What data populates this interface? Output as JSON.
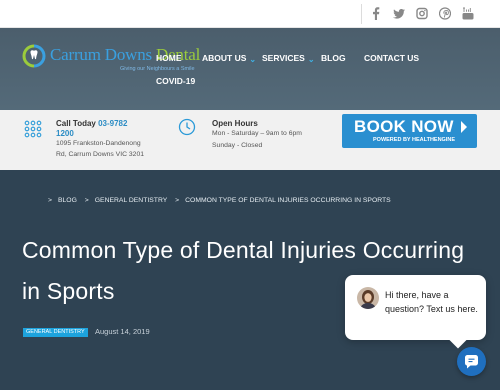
{
  "social": {
    "icons": [
      "facebook-icon",
      "twitter-icon",
      "instagram-icon",
      "pinterest-icon",
      "youtube-icon"
    ],
    "color": "#888888"
  },
  "brand": {
    "name_part1": "Carrum Downs ",
    "name_part2": "Dental",
    "tagline": "Giving our Neighbours a Smile",
    "blue": "#3aa0e0",
    "green": "#9bcc3c"
  },
  "nav": {
    "home": "HOME",
    "about": "ABOUT US",
    "services": "SERVICES",
    "blog": "BLOG",
    "contact": "CONTACT US",
    "covid": "COVID-19"
  },
  "contact": {
    "call_label": "Call Today ",
    "phone_part1": "03-9782",
    "phone_part2": "1200",
    "address_line1": "1095 Frankston-Dandenong",
    "address_line2": "Rd, Carrum Downs VIC 3201"
  },
  "hours": {
    "title": "Open Hours",
    "line1": "Mon - Saturday – 9am to 6pm",
    "line2": "Sunday - Closed"
  },
  "book": {
    "label": "BOOK NOW",
    "powered": "POWERED BY HEALTHENGINE",
    "color": "#2a8fd0"
  },
  "breadcrumb": {
    "items": [
      "BLOG",
      "GENERAL DENTISTRY",
      "COMMON TYPE OF DENTAL INJURIES OCCURRING IN SPORTS"
    ],
    "separator": ">"
  },
  "post": {
    "title": "Common Type of Dental Injuries Occurring in Sports",
    "category": "GENERAL DENTISTRY",
    "date": "August 14, 2019"
  },
  "chat": {
    "message": "Hi there, have a question? Text us here."
  }
}
